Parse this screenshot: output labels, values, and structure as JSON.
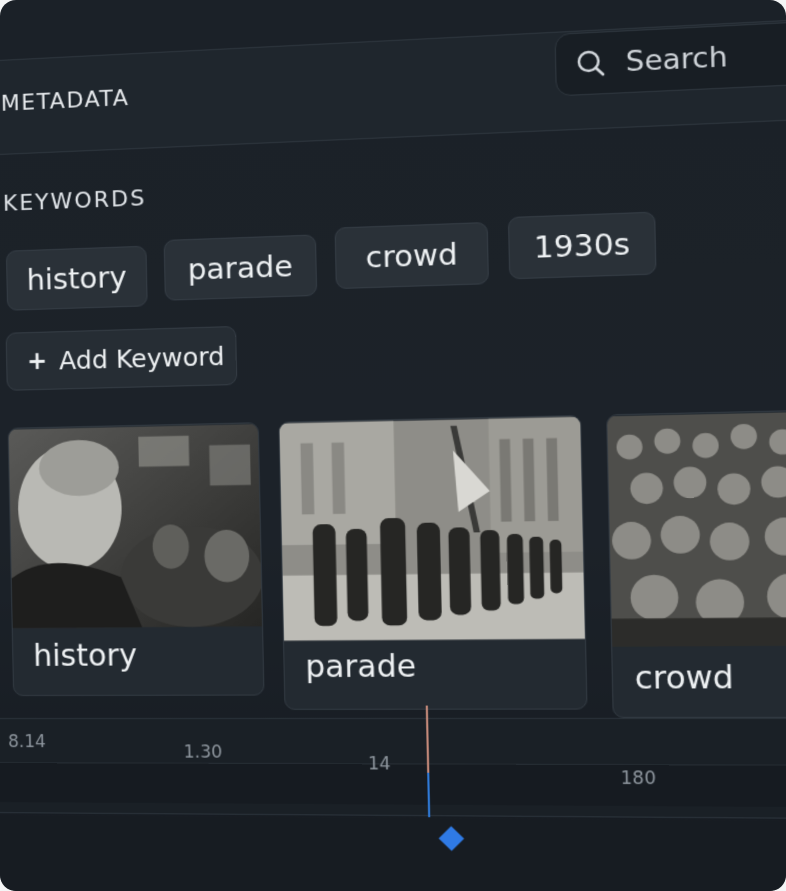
{
  "header": {
    "title": "METADATA"
  },
  "search": {
    "placeholder": "Search"
  },
  "keywords": {
    "label": "KEYWORDS",
    "chips": [
      "history",
      "parade",
      "crowd",
      "1930s"
    ],
    "add_label": "Add Keyword"
  },
  "cards": [
    {
      "label": "history"
    },
    {
      "label": "parade"
    },
    {
      "label": "crowd"
    }
  ],
  "timeline": {
    "ticks": [
      "8.14",
      "1.30",
      "14",
      "180"
    ]
  },
  "colors": {
    "background": "#1c2229",
    "accent": "#2f7ae5",
    "playhead_top": "#c58a7a"
  }
}
